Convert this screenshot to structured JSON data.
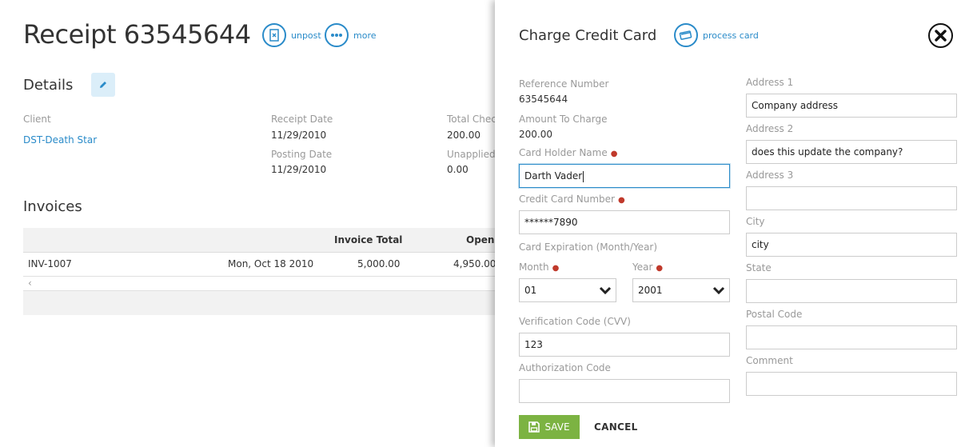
{
  "receipt": {
    "title": "Receipt 63545644",
    "actions": {
      "unpost": "unpost",
      "more": "more"
    }
  },
  "details": {
    "heading": "Details",
    "client_label": "Client",
    "client_value": "DST-Death Star",
    "receipt_date_label": "Receipt Date",
    "receipt_date_value": "11/29/2010",
    "posting_date_label": "Posting Date",
    "posting_date_value": "11/29/2010",
    "total_check_label": "Total Check",
    "total_check_value": "200.00",
    "unapplied_label": "Unapplied",
    "unapplied_value": "0.00"
  },
  "invoices": {
    "heading": "Invoices",
    "columns": [
      "Invoice Total",
      "Open"
    ],
    "rows": [
      {
        "invoice": "INV-1007",
        "date": "Mon, Oct 18 2010",
        "total": "5,000.00",
        "open": "4,950.00"
      }
    ],
    "scroll_left": "‹"
  },
  "drawer": {
    "title": "Charge Credit Card",
    "process_card": "process card",
    "reference_number_label": "Reference Number",
    "reference_number_value": "63545644",
    "amount_label": "Amount To Charge",
    "amount_value": "200.00",
    "card_holder_label": "Card Holder Name",
    "card_holder_value": "Darth Vader",
    "card_number_label": "Credit Card Number",
    "card_number_value": "******7890",
    "expiration_label": "Card Expiration (Month/Year)",
    "month_label": "Month",
    "month_value": "01",
    "year_label": "Year",
    "year_value": "2001",
    "cvv_label": "Verification Code (CVV)",
    "cvv_value": "123",
    "auth_code_label": "Authorization Code",
    "auth_code_value": "",
    "address1_label": "Address 1",
    "address1_value": "Company address",
    "address2_label": "Address 2",
    "address2_value": "does this update the company?",
    "address3_label": "Address 3",
    "address3_value": "",
    "city_label": "City",
    "city_value": "city",
    "state_label": "State",
    "state_value": "",
    "postal_label": "Postal Code",
    "postal_value": "",
    "comment_label": "Comment",
    "comment_value": "",
    "required_marker": "●",
    "save_label": "SAVE",
    "cancel_label": "CANCEL"
  },
  "colors": {
    "accent_blue": "#2a8bc9",
    "save_green": "#7cb342",
    "required_red": "#c0392b"
  },
  "icons": [
    "unpost-icon",
    "more-icon",
    "pencil-icon",
    "process-card-icon",
    "close-icon",
    "chevron-down-icon",
    "floppy-disk-icon"
  ]
}
